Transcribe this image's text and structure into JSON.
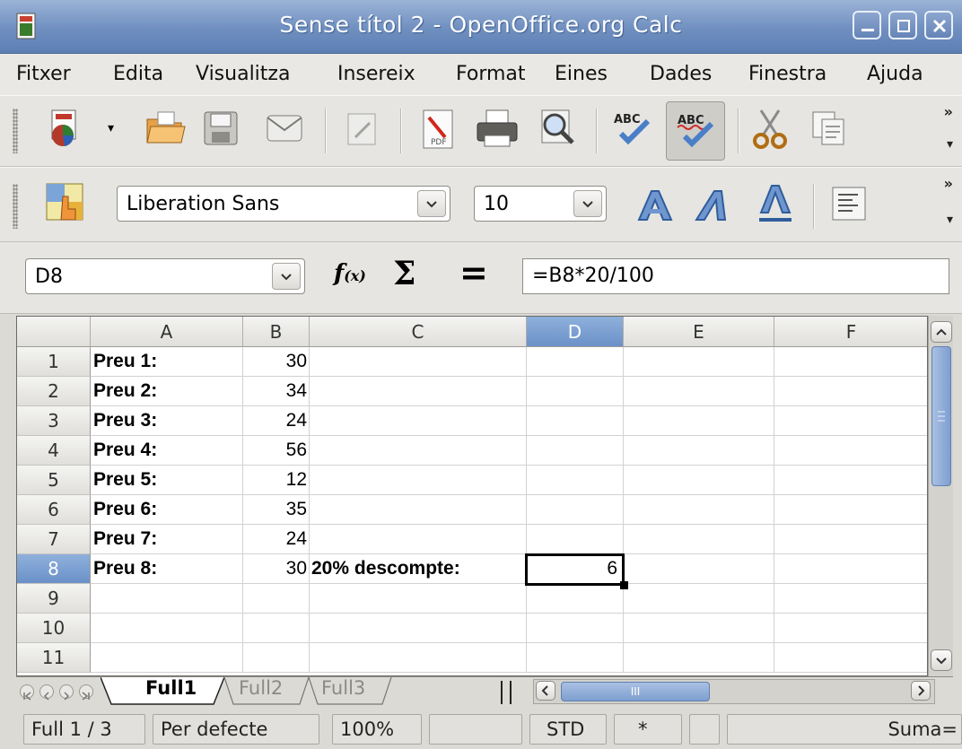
{
  "window": {
    "title": "Sense títol 2 - OpenOffice.org Calc"
  },
  "menu": [
    "Fitxer",
    "Edita",
    "Visualitza",
    "Insereix",
    "Format",
    "Eines",
    "Dades",
    "Finestra",
    "Ajuda"
  ],
  "formatting": {
    "font_name": "Liberation Sans",
    "font_size": "10"
  },
  "formula_bar": {
    "name_box": "D8",
    "formula": "=B8*20/100"
  },
  "columns": [
    "A",
    "B",
    "C",
    "D",
    "E",
    "F"
  ],
  "selected_column": "D",
  "rows": [
    {
      "n": "1",
      "a": "Preu 1:",
      "b": "30",
      "c": "",
      "d": ""
    },
    {
      "n": "2",
      "a": "Preu 2:",
      "b": "34",
      "c": "",
      "d": ""
    },
    {
      "n": "3",
      "a": "Preu 3:",
      "b": "24",
      "c": "",
      "d": ""
    },
    {
      "n": "4",
      "a": "Preu 4:",
      "b": "56",
      "c": "",
      "d": ""
    },
    {
      "n": "5",
      "a": "Preu 5:",
      "b": "12",
      "c": "",
      "d": ""
    },
    {
      "n": "6",
      "a": "Preu 6:",
      "b": "35",
      "c": "",
      "d": ""
    },
    {
      "n": "7",
      "a": "Preu 7:",
      "b": "24",
      "c": "",
      "d": ""
    },
    {
      "n": "8",
      "a": "Preu 8:",
      "b": "30",
      "c": "20%  descompte:",
      "d": "6"
    },
    {
      "n": "9",
      "a": "",
      "b": "",
      "c": "",
      "d": ""
    },
    {
      "n": "10",
      "a": "",
      "b": "",
      "c": "",
      "d": ""
    },
    {
      "n": "11",
      "a": "",
      "b": "",
      "c": "",
      "d": ""
    }
  ],
  "selected_row": "8",
  "sheets": [
    "Full1",
    "Full2",
    "Full3"
  ],
  "active_sheet": "Full1",
  "hscroll_mark": "III",
  "status": {
    "sheet": "Full 1 / 3",
    "style": "Per defecte",
    "zoom": "100%",
    "mode": "STD",
    "modified": "*",
    "sum": "Suma="
  },
  "colors": {
    "accent": "#6a91c8",
    "titlebar": "#6f8fc0"
  }
}
